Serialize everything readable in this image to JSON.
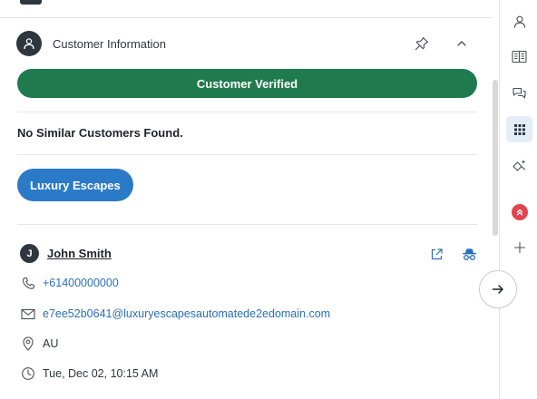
{
  "header": {
    "title": "Customer Information",
    "icon": "user-icon",
    "pin_icon": "pin-icon",
    "collapse_icon": "chevron-up-icon"
  },
  "verification": {
    "label": "Customer Verified",
    "color": "#1f7a4d"
  },
  "similar_customers": {
    "message": "No Similar Customers Found."
  },
  "brand": {
    "label": "Luxury Escapes",
    "color": "#2b7ac7"
  },
  "customer": {
    "initial": "J",
    "name": "John Smith",
    "open_icon": "external-link-icon",
    "incognito_icon": "incognito-icon",
    "phone": "+61400000000",
    "email": "e7ee52b0641@luxuryescapesautomatede2edomain.com",
    "country": "AU",
    "local_time": "Tue, Dec 02, 10:15 AM"
  },
  "rail": {
    "items": [
      {
        "icon": "user-icon",
        "active": false
      },
      {
        "icon": "book-icon",
        "active": false
      },
      {
        "icon": "chat-bubbles-icon",
        "active": false
      },
      {
        "icon": "apps-grid-icon",
        "active": true
      },
      {
        "icon": "magic-wand-icon",
        "active": false
      },
      {
        "icon": "app-badge-icon",
        "active": false
      },
      {
        "icon": "plus-icon",
        "active": false
      }
    ],
    "active_color": "#e4eef8"
  },
  "floating_action": {
    "icon": "arrow-right-icon"
  }
}
